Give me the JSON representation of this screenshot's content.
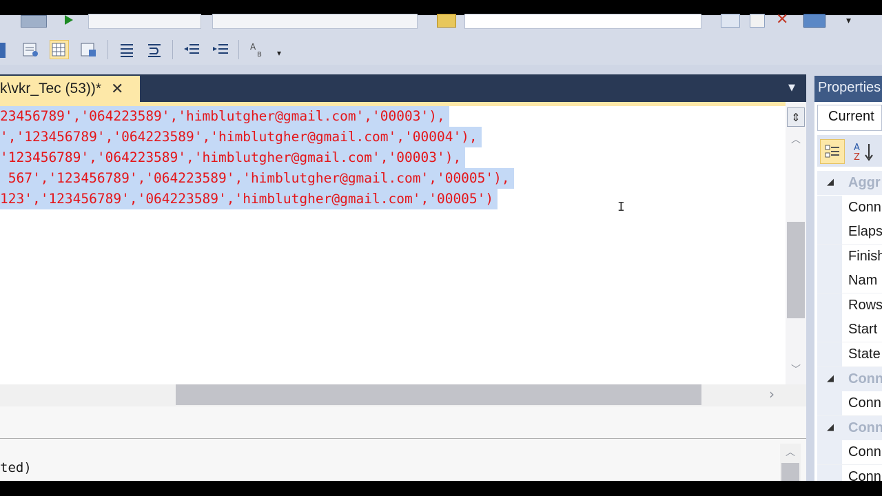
{
  "document": {
    "tab_title": "k\\vkr_Tec (53))*",
    "code_lines": [
      "23456789','064223589','himblutgher@gmail.com','00003'),",
      "','123456789','064223589','himblutgher@gmail.com','00004'),",
      "'123456789','064223589','himblutgher@gmail.com','00003'),",
      " 567','123456789','064223589','himblutgher@gmail.com','00005'),",
      "123','123456789','064223589','himblutgher@gmail.com','00005')"
    ]
  },
  "results": {
    "message": "ted)"
  },
  "properties": {
    "title": "Properties",
    "object_selector": "Current",
    "rows": [
      {
        "kind": "category",
        "label": "Aggr"
      },
      {
        "kind": "item",
        "label": "Conn"
      },
      {
        "kind": "item",
        "label": "Elaps"
      },
      {
        "kind": "item",
        "label": "Finish"
      },
      {
        "kind": "item",
        "label": "Nam"
      },
      {
        "kind": "item",
        "label": "Rows"
      },
      {
        "kind": "item",
        "label": "Start"
      },
      {
        "kind": "item",
        "label": "State"
      },
      {
        "kind": "category",
        "label": "Conn"
      },
      {
        "kind": "item",
        "label": "Conn"
      },
      {
        "kind": "category",
        "label": "Conn"
      },
      {
        "kind": "item",
        "label": "Conn"
      },
      {
        "kind": "item",
        "label": "Conn"
      }
    ]
  },
  "icons": {
    "tab_close": "close-icon",
    "tab_dropdown": "chevron-down-icon",
    "split": "split-icon",
    "scroll_up": "chevron-up-icon",
    "scroll_down": "chevron-down-icon",
    "scroll_right": "chevron-right-icon",
    "categorized": "categorized-icon",
    "alphabetical": "sort-alpha-icon"
  },
  "colors": {
    "selection": "#c4d9f6",
    "string_literal": "#e4161a",
    "active_tab": "#fde8a8",
    "tool_window_header": "#3e5a86"
  }
}
